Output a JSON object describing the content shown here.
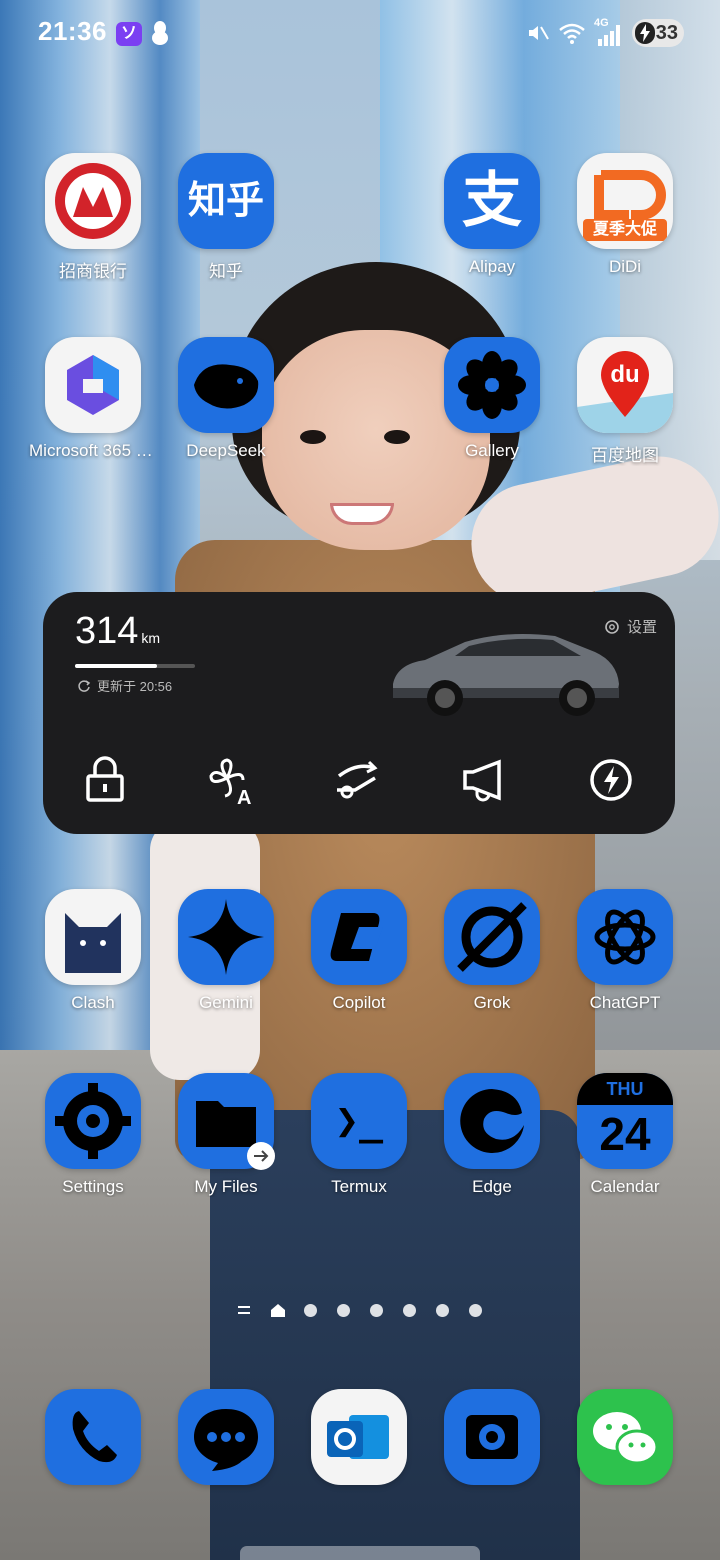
{
  "status_bar": {
    "time": "21:36",
    "network_type": "4G",
    "battery_level": "33",
    "icons": [
      "unknown-purple-app-icon",
      "qq-penguin-icon",
      "mute-icon",
      "wifi-icon",
      "signal-icon",
      "battery-charging-icon"
    ]
  },
  "row1": [
    {
      "label": "招商银行",
      "icon": "cmb-bank-icon"
    },
    {
      "label": "知乎",
      "icon": "zhihu-icon",
      "glyph": "知乎"
    },
    {
      "label": "Alipay",
      "icon": "alipay-icon",
      "glyph": "支"
    },
    {
      "label": "DiDi",
      "icon": "didi-icon",
      "badge": "夏季大促"
    }
  ],
  "row2": [
    {
      "label": "Microsoft 365 (Of...",
      "icon": "microsoft-365-icon"
    },
    {
      "label": "DeepSeek",
      "icon": "deepseek-whale-icon"
    },
    {
      "label": "Gallery",
      "icon": "gallery-flower-icon"
    },
    {
      "label": "百度地图",
      "icon": "baidu-maps-icon",
      "glyph": "du"
    }
  ],
  "car_widget": {
    "range_value": "314",
    "range_unit": "km",
    "range_fraction": 0.68,
    "updated_text": "更新于 20:56",
    "settings_label": "设置",
    "controls": [
      "lock-icon",
      "climate-fan-icon",
      "trunk-icon",
      "horn-icon",
      "charge-icon"
    ]
  },
  "row3": [
    {
      "label": "Clash",
      "icon": "clash-cat-icon"
    },
    {
      "label": "Gemini",
      "icon": "gemini-star-icon"
    },
    {
      "label": "Copilot",
      "icon": "copilot-icon"
    },
    {
      "label": "Grok",
      "icon": "grok-icon"
    },
    {
      "label": "ChatGPT",
      "icon": "chatgpt-icon"
    }
  ],
  "row4": [
    {
      "label": "Settings",
      "icon": "settings-gear-icon"
    },
    {
      "label": "My Files",
      "icon": "folder-icon"
    },
    {
      "label": "Termux",
      "icon": "terminal-icon",
      "glyph": "❯_"
    },
    {
      "label": "Edge",
      "icon": "edge-icon"
    },
    {
      "label": "Calendar",
      "icon": "calendar-icon",
      "weekday": "THU",
      "day": "24"
    }
  ],
  "pager": {
    "page_count": 6,
    "current": "home"
  },
  "dock": [
    {
      "icon": "phone-icon"
    },
    {
      "icon": "messages-icon"
    },
    {
      "icon": "outlook-icon"
    },
    {
      "icon": "camera-icon"
    },
    {
      "icon": "wechat-icon"
    }
  ],
  "colors": {
    "icon_blue": "#1f6fe0",
    "widget_bg": "#1c1c1e",
    "cmb_red": "#d2232a",
    "wechat_green": "#2dc24d",
    "didi_orange": "#f26a22"
  }
}
